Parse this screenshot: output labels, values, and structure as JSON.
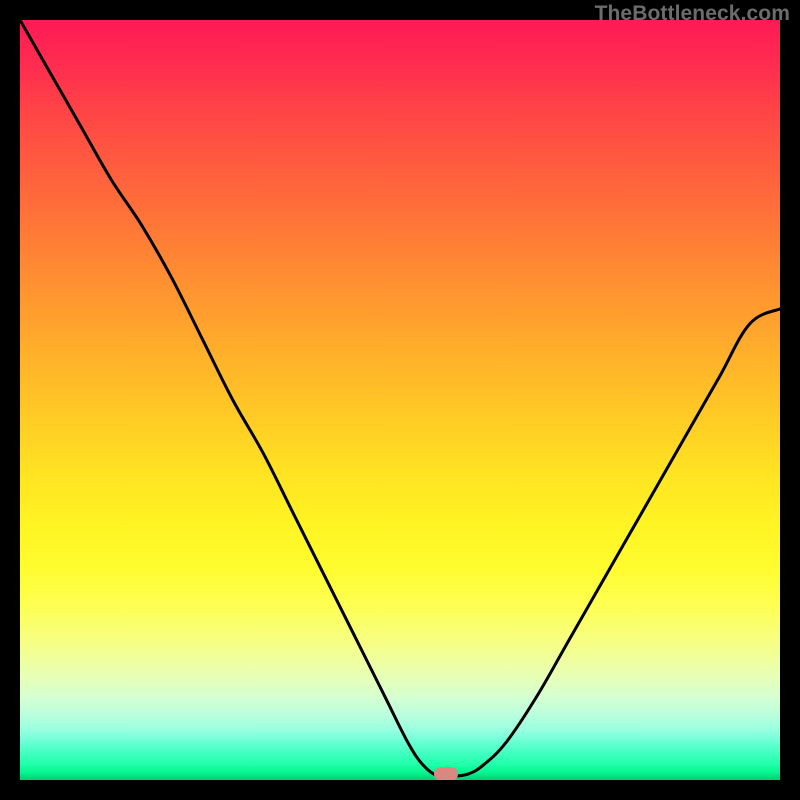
{
  "watermark": "TheBottleneck.com",
  "marker": {
    "x_pct": 56.0,
    "y_pct": 99.2
  },
  "chart_data": {
    "type": "line",
    "title": "",
    "xlabel": "",
    "ylabel": "",
    "xlim": [
      0,
      100
    ],
    "ylim": [
      0,
      100
    ],
    "x": [
      0,
      4,
      8,
      12,
      16,
      20,
      24,
      28,
      32,
      36,
      40,
      44,
      48,
      51,
      53,
      55,
      57,
      59,
      61,
      64,
      68,
      72,
      76,
      80,
      84,
      88,
      92,
      96,
      100
    ],
    "values": [
      100,
      93,
      86,
      79,
      73,
      66,
      58,
      50,
      43,
      35,
      27,
      19,
      11,
      5,
      2,
      0.5,
      0.5,
      0.8,
      2,
      5,
      11,
      18,
      25,
      32,
      39,
      46,
      53,
      60,
      62
    ],
    "annotations": [
      {
        "label": "marker",
        "x": 56,
        "y": 0.8
      }
    ]
  }
}
